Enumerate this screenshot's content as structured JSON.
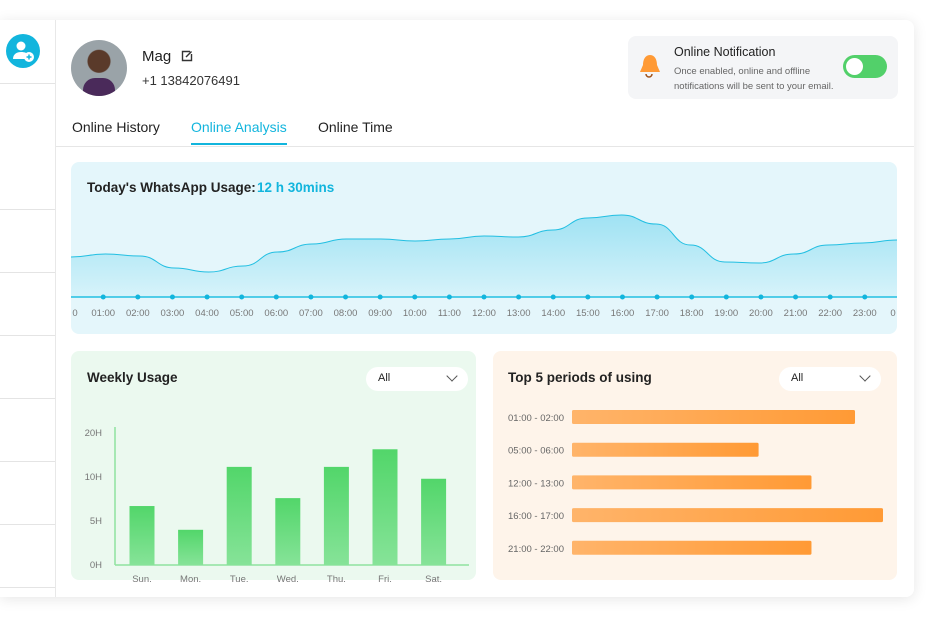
{
  "profile": {
    "name": "Mag",
    "phone": "+1 13842076491"
  },
  "notification": {
    "title": "Online Notification",
    "description": "Once enabled, online and offline notifications will be sent to your email.",
    "enabled": true
  },
  "tabs": [
    {
      "label": "Online History"
    },
    {
      "label": "Online Analysis",
      "active": true
    },
    {
      "label": "Online Time"
    }
  ],
  "colors": {
    "accent": "#12b5dd",
    "green": "#52d06a",
    "orange": "#ff9a35"
  },
  "chart_data": [
    {
      "type": "area",
      "title": "Today's WhatsApp Usage:",
      "total": "12 h 30mins",
      "x_labels": [
        "0",
        "01:00",
        "02:00",
        "03:00",
        "04:00",
        "05:00",
        "06:00",
        "07:00",
        "08:00",
        "09:00",
        "10:00",
        "11:00",
        "12:00",
        "13:00",
        "14:00",
        "15:00",
        "16:00",
        "17:00",
        "18:00",
        "19:00",
        "20:00",
        "21:00",
        "22:00",
        "23:00",
        "0"
      ],
      "values": [
        40,
        43,
        41,
        29,
        25,
        31,
        45,
        53,
        58,
        58,
        56,
        58,
        61,
        60,
        67,
        79,
        82,
        73,
        52,
        35,
        34,
        43,
        52,
        54,
        57
      ]
    },
    {
      "type": "bar",
      "title": "Weekly Usage",
      "filter": "All",
      "categories": [
        "Sun.",
        "Mon.",
        "Tue.",
        "Wed.",
        "Thu.",
        "Fri.",
        "Sat."
      ],
      "values": [
        6.7,
        4,
        12.3,
        7.6,
        12.3,
        16.3,
        9.8
      ],
      "y_ticks": [
        "0H",
        "5H",
        "10H",
        "20H"
      ],
      "y_tick_values": [
        0,
        5,
        10,
        20
      ]
    },
    {
      "type": "bar",
      "orientation": "horizontal",
      "title": "Top 5 periods of using",
      "filter": "All",
      "categories": [
        "01:00 - 02:00",
        "05:00 - 06:00",
        "12:00 - 13:00",
        "16:00 - 17:00",
        "21:00 - 22:00"
      ],
      "values": [
        0.91,
        0.6,
        0.77,
        1.0,
        0.77
      ]
    }
  ]
}
